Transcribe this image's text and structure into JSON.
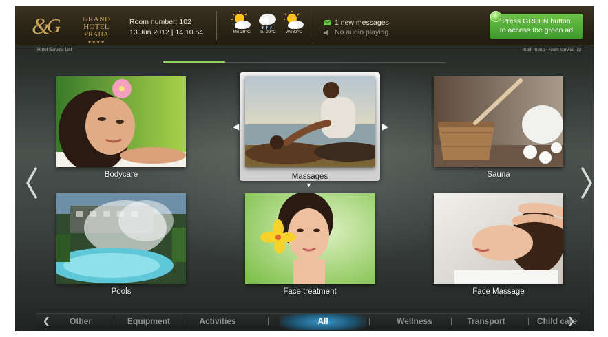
{
  "header": {
    "hotel_name": "GRAND HOTEL",
    "hotel_city": "PRAHA",
    "hotel_stars": "★★★★",
    "room_label": "Room number: 102",
    "datetime": "13.Jun.2012 | 14.10.54",
    "weather": [
      {
        "day": "Mo",
        "temp": "29°C",
        "label": "Mo 29°C",
        "icon": "sun-cloud-icon"
      },
      {
        "day": "Tu",
        "temp": "29°C",
        "label": "Tu 29°C",
        "icon": "cloud-rain-icon"
      },
      {
        "day": "We",
        "temp": "32°C",
        "label": "We32°C",
        "icon": "sun-cloud-icon"
      }
    ],
    "messages": "1 new messages",
    "audio": "No audio playing",
    "green_ad": "Press GREEN button to access the green ad"
  },
  "subbar": {
    "left": "Hotel Service List",
    "right": "main menu › room service list"
  },
  "progress": 0.22,
  "tiles": [
    {
      "label": "Bodycare"
    },
    {
      "label": "Massages",
      "selected": true
    },
    {
      "label": "Sauna"
    },
    {
      "label": "Pools"
    },
    {
      "label": "Face treatment"
    },
    {
      "label": "Face Massage"
    }
  ],
  "categories": {
    "items": [
      "Other",
      "Equipment",
      "Activities",
      "All",
      "Wellness",
      "Transport",
      "Child care"
    ],
    "active": "All"
  },
  "colors": {
    "header_gold": "#c9a65b",
    "green_button": "#4fae33",
    "active_category": "#3d95c8"
  }
}
